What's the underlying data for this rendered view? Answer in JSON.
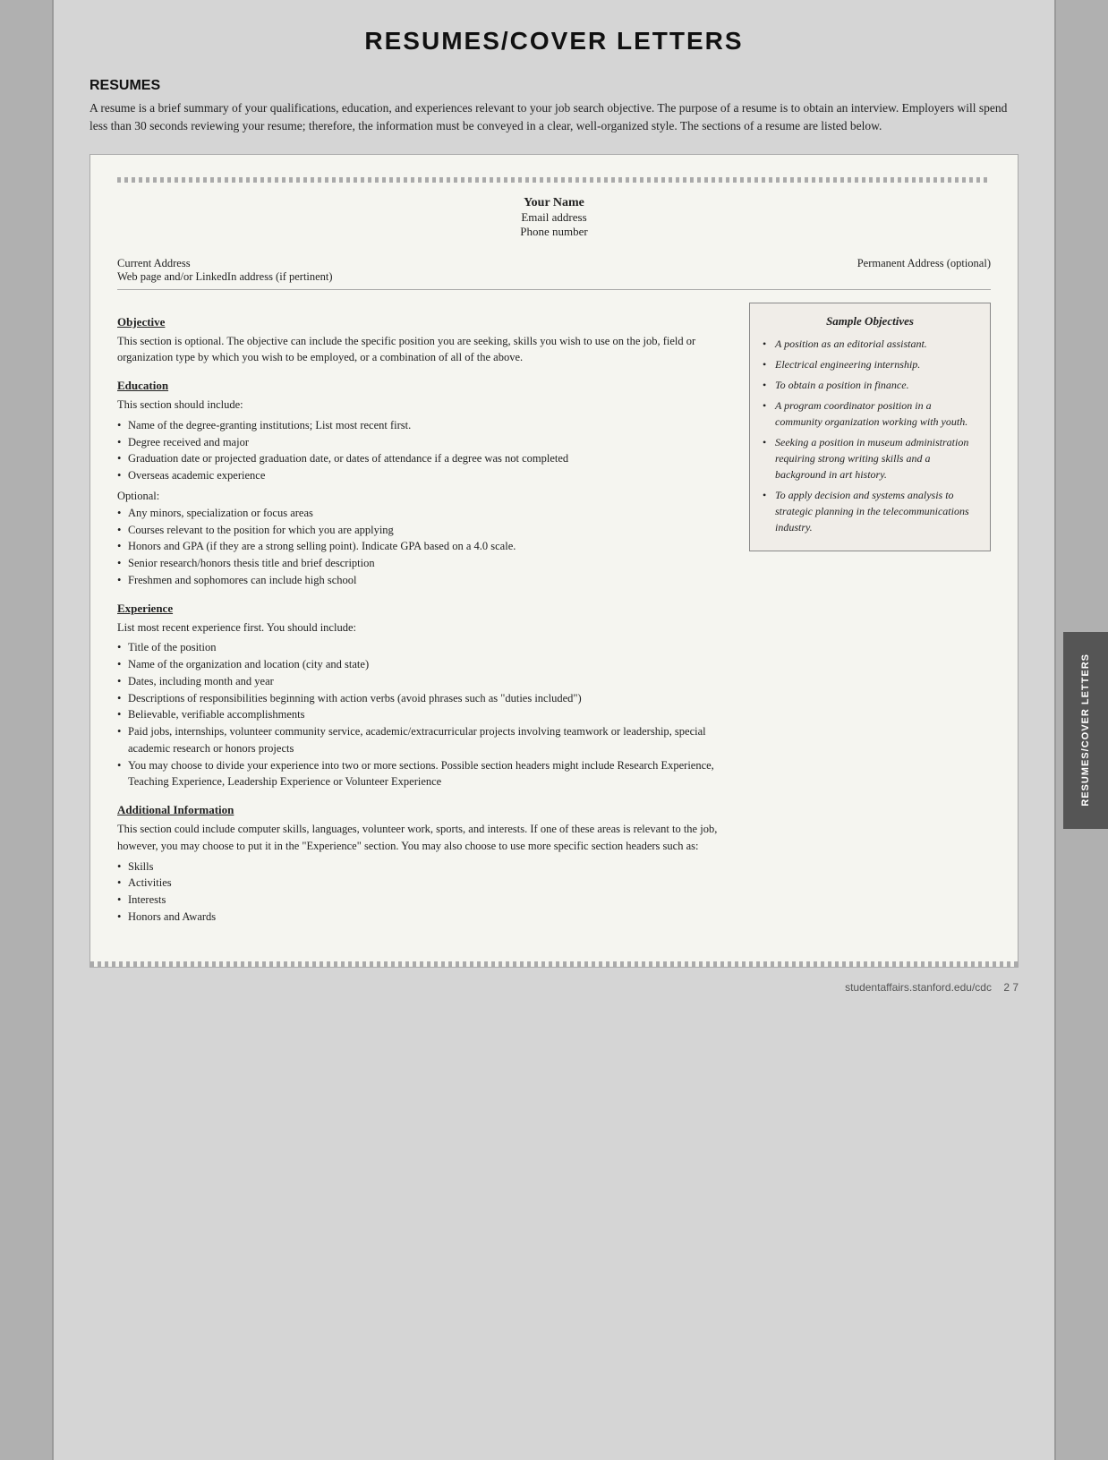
{
  "page": {
    "title": "RESUMES/COVER LETTERS",
    "footer_url": "studentaffairs.stanford.edu/cdc",
    "footer_page": "2 7",
    "right_tab_label": "RESUMES/COVER LETTERS"
  },
  "resumes_section": {
    "heading": "RESUMES",
    "intro": "A resume is a brief summary of your qualifications, education, and experiences relevant to your job search objective. The purpose of a resume is to obtain an interview. Employers will spend less than 30 seconds reviewing your resume; therefore, the information must be conveyed in a clear, well-organized style. The sections of a resume are listed below."
  },
  "doc": {
    "name": "Your Name",
    "email": "Email address",
    "phone": "Phone number",
    "current_address": "Current Address",
    "web_address": "Web page and/or LinkedIn address (if pertinent)",
    "permanent_address": "Permanent Address (optional)",
    "objective_title": "Objective",
    "objective_text": "This section is optional. The objective can include the specific position you are seeking, skills you wish to use on the job, field or organization type by which you wish to be employed, or a combination of all of the above.",
    "education_title": "Education",
    "education_intro": "This section should include:",
    "education_items": [
      "Name of the degree-granting institutions; List most recent first.",
      "Degree received and major",
      "Graduation date or projected graduation date, or dates of attendance if a degree was not completed",
      "Overseas academic experience"
    ],
    "optional_label": "Optional:",
    "optional_items": [
      "Any minors, specialization or focus areas",
      "Courses relevant to the position for which you are applying",
      "Honors and GPA (if they are a strong selling point). Indicate GPA based on a 4.0 scale.",
      "Senior research/honors thesis title and brief description",
      "Freshmen and sophomores can include high school"
    ],
    "experience_title": "Experience",
    "experience_intro": "List most recent experience first. You should include:",
    "experience_items": [
      "Title of the position",
      "Name of the organization and location (city and state)",
      "Dates, including month and year",
      "Descriptions of responsibilities beginning with action verbs (avoid phrases such as \"duties included\")",
      "Believable, verifiable accomplishments",
      "Paid jobs, internships, volunteer community service, academic/extracurricular projects involving teamwork or leadership, special academic research or honors projects",
      "You may choose to divide your experience into two or more sections. Possible section headers might include Research Experience, Teaching Experience, Leadership Experience or Volunteer Experience"
    ],
    "additional_title": "Additional Information",
    "additional_text": "This section could include computer skills, languages, volunteer work, sports, and interests. If one of these areas is relevant to the job, however, you may choose to put it in the \"Experience\" section. You may also choose to use more specific section headers such as:",
    "additional_items": [
      "Skills",
      "Activities",
      "Interests",
      "Honors and Awards"
    ]
  },
  "sample_objectives": {
    "title": "Sample Objectives",
    "items": [
      "A position as an editorial assistant.",
      "Electrical engineering internship.",
      "To obtain a position in finance.",
      "A program coordinator position in a community organization working with youth.",
      "Seeking a position in museum administration requiring strong writing skills and a background in art history.",
      "To apply decision and systems analysis to strategic planning in the telecommunications industry."
    ]
  }
}
